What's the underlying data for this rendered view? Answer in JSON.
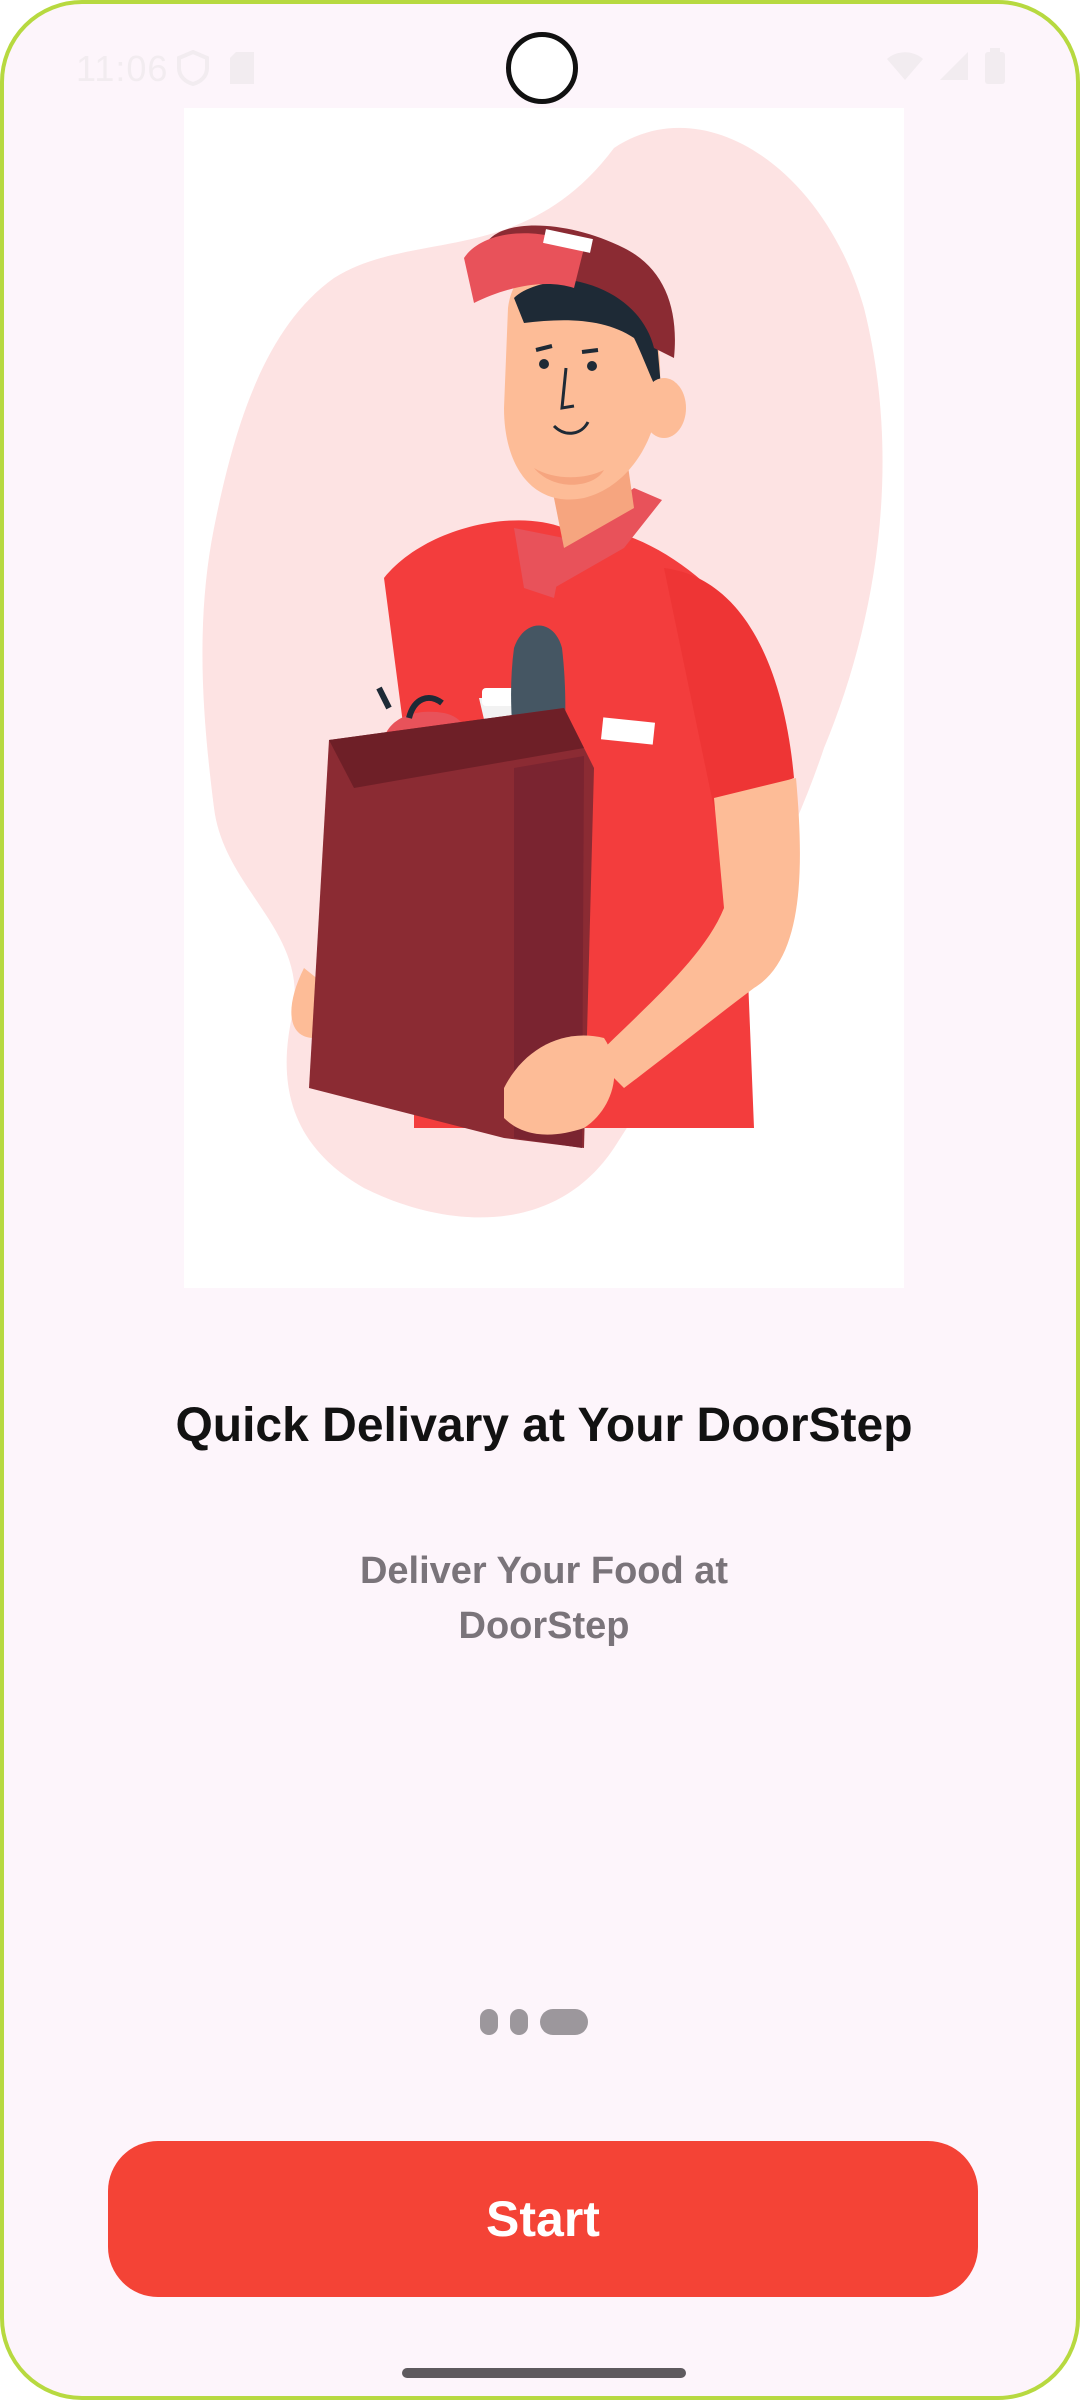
{
  "status_bar": {
    "time": "11:06",
    "icons": [
      "shield-icon",
      "sim-card-icon",
      "wifi-icon",
      "signal-icon",
      "battery-icon"
    ]
  },
  "onboarding": {
    "title": "Quick Delivary at Your DoorStep",
    "subtitle": "Deliver Your Food at DoorStep",
    "page_count": 3,
    "active_page": 3
  },
  "start_button": {
    "label": "Start"
  },
  "colors": {
    "background": "#fdf5fb",
    "accent": "#f44336",
    "frame": "#b7d940"
  }
}
